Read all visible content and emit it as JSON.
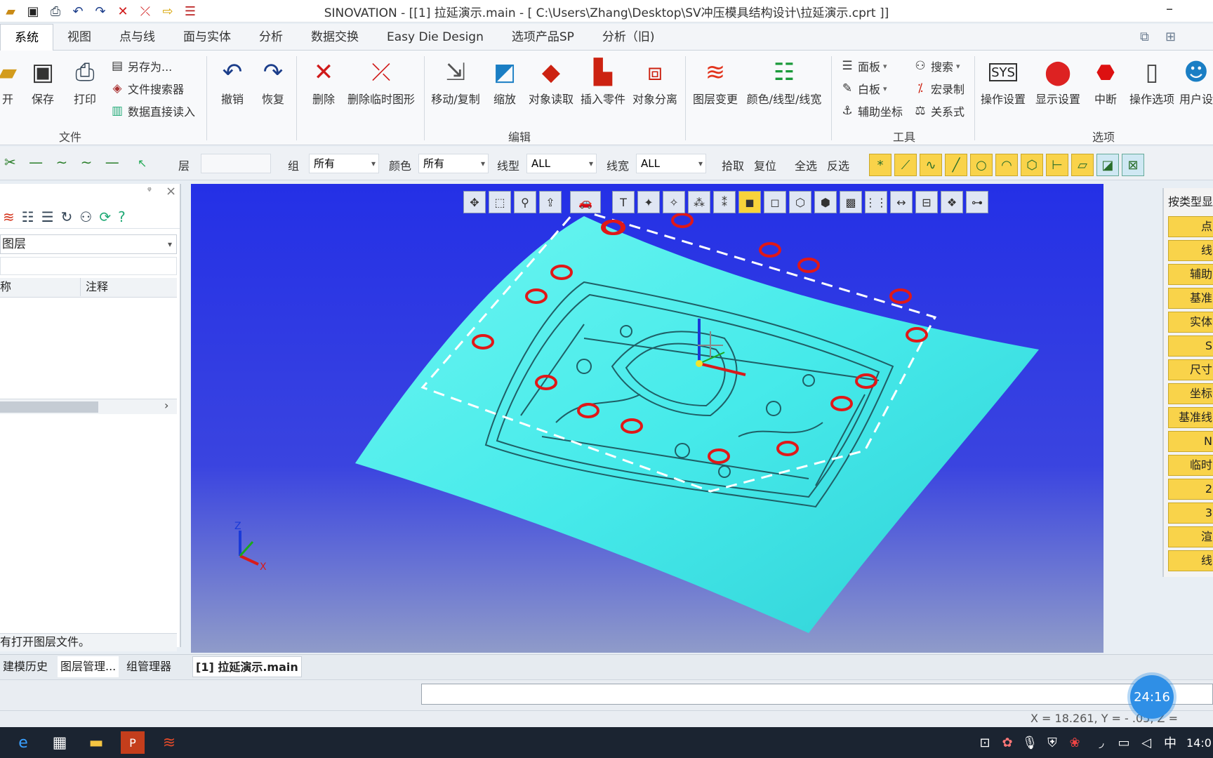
{
  "window": {
    "title": "SINOVATION - [[1] 拉延演示.main - [ C:\\Users\\Zhang\\Desktop\\SV冲压模具结构设计\\拉延演示.cprt ]]",
    "minimize": "–"
  },
  "qat": [
    "open-icon",
    "save-icon",
    "print-icon",
    "undo-icon",
    "redo-icon",
    "delete-icon",
    "delete-temp-icon",
    "arrow-icon",
    "list-icon"
  ],
  "menu": [
    "系统",
    "视图",
    "点与线",
    "面与实体",
    "分析",
    "数据交换",
    "Easy Die Design",
    "选项产品SP",
    "分析（旧)"
  ],
  "ribbon": {
    "file": {
      "open": "开",
      "save": "保存",
      "print": "打印",
      "saveas": "另存为...",
      "search": "文件搜索器",
      "direct": "数据直接读入",
      "group": "文件"
    },
    "edit": {
      "undo": "撤销",
      "redo": "恢复",
      "delete": "删除",
      "deltemp": "删除临时图形",
      "move": "移动/复制",
      "scale": "缩放",
      "read": "对象读取",
      "insert": "插入零件",
      "separate": "对象分离",
      "layer": "图层变更",
      "color": "颜色/线型/线宽",
      "group": "编辑"
    },
    "tools": {
      "panel": "面板",
      "white": "白板",
      "aux": "辅助坐标",
      "search": "搜索",
      "macro": "宏录制",
      "rel": "关系式",
      "group": "工具"
    },
    "options": {
      "opset": "操作设置",
      "dispset": "显示设置",
      "stop": "中断",
      "opopt": "操作选项",
      "user": "用户设",
      "group": "选项"
    }
  },
  "filter": {
    "layer": "层",
    "group": "组",
    "group_val": "所有",
    "color": "颜色",
    "color_val": "所有",
    "ltype": "线型",
    "ltype_val": "ALL",
    "lwidth": "线宽",
    "lwidth_val": "ALL",
    "pick": "拾取",
    "reset": "复位",
    "selall": "全选",
    "invert": "反选"
  },
  "leftpanel": {
    "pin": "ᵠ",
    "close": "×",
    "dropdown": "图层",
    "col1": "称",
    "col2": "注释",
    "status": "有打开图层文件。"
  },
  "bottomtabs": [
    "建模历史",
    "图层管理...",
    "组管理器",
    "[1] 拉延演示.main"
  ],
  "rightpanel": {
    "title": "按类型显",
    "items": [
      "点",
      "线",
      "辅助",
      "基准",
      "实体",
      "S",
      "尺寸",
      "坐标",
      "基准线",
      "N",
      "临时",
      "2",
      "3",
      "渲",
      "线"
    ]
  },
  "status": {
    "coords": "X =    18.261, Y = -    .05, Z ="
  },
  "timer": "24:16",
  "taskbar": {
    "lang": "中",
    "time": "14:0"
  },
  "colors": {
    "ribbon_bg": "#f8f9fb",
    "viewport": "#2430e6",
    "part": "#4ff0f0",
    "accent": "#f9d34a"
  }
}
